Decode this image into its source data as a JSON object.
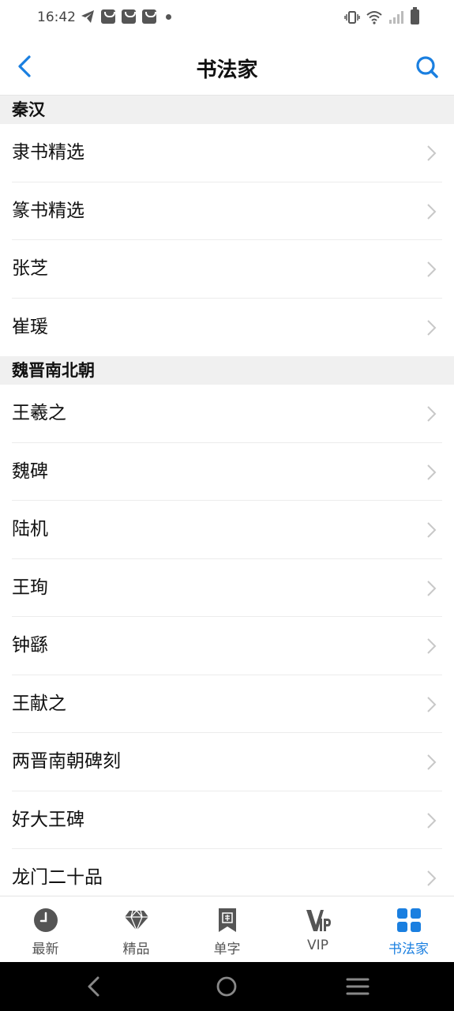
{
  "status_bar": {
    "time": "16:42"
  },
  "nav": {
    "title": "书法家"
  },
  "sections": [
    {
      "title": "秦汉",
      "items": [
        "隶书精选",
        "篆书精选",
        "张芝",
        "崔瑗"
      ]
    },
    {
      "title": "魏晋南北朝",
      "items": [
        "王羲之",
        "魏碑",
        "陆机",
        "王珣",
        "钟繇",
        "王献之",
        "两晋南朝碑刻",
        "好大王碑",
        "龙门二十品"
      ]
    }
  ],
  "tabs": [
    {
      "label": "最新",
      "icon": "clock-icon"
    },
    {
      "label": "精品",
      "icon": "diamond-icon"
    },
    {
      "label": "单字",
      "icon": "bookmark-seal-icon"
    },
    {
      "label": "VIP",
      "icon": "vip-icon"
    },
    {
      "label": "书法家",
      "icon": "grid-icon"
    }
  ],
  "colors": {
    "accent": "#1a7fe0",
    "section_bg": "#f0f0f0"
  }
}
